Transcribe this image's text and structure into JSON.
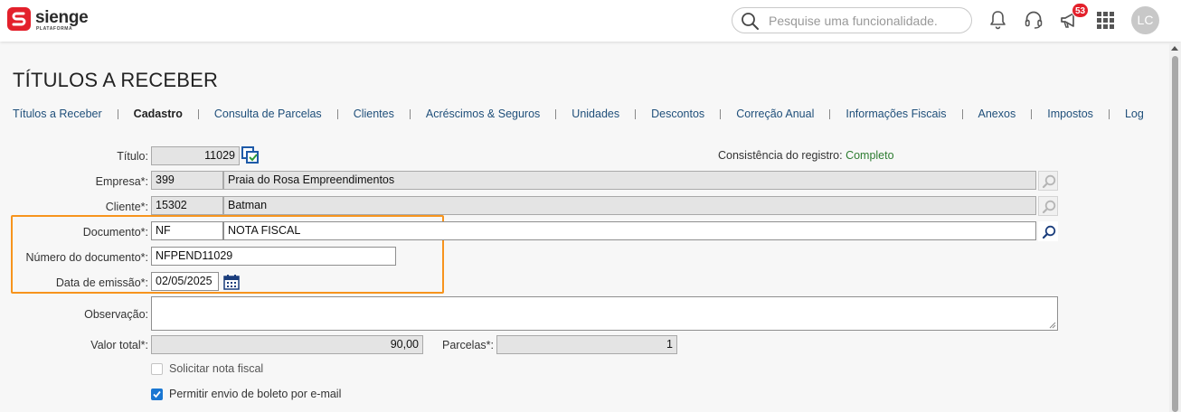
{
  "header": {
    "brand": "sienge",
    "brand_sub": "PLATAFORMA",
    "search_placeholder": "Pesquise uma funcionalidade.",
    "notifications_count": "53",
    "avatar_initials": "LC"
  },
  "page": {
    "title": "TÍTULOS A RECEBER"
  },
  "tabs": [
    {
      "label": "Títulos a Receber"
    },
    {
      "label": "Cadastro"
    },
    {
      "label": "Consulta de Parcelas"
    },
    {
      "label": "Clientes"
    },
    {
      "label": "Acréscimos & Seguros"
    },
    {
      "label": "Unidades"
    },
    {
      "label": "Descontos"
    },
    {
      "label": "Correção Anual"
    },
    {
      "label": "Informações Fiscais"
    },
    {
      "label": "Anexos"
    },
    {
      "label": "Impostos"
    },
    {
      "label": "Log"
    }
  ],
  "form": {
    "titulo": {
      "label": "Título:",
      "value": "11029"
    },
    "consistencia": {
      "label": "Consistência do registro:",
      "value": "Completo"
    },
    "empresa": {
      "label": "Empresa*:",
      "code": "399",
      "name": "Praia do Rosa Empreendimentos"
    },
    "cliente": {
      "label": "Cliente*:",
      "code": "15302",
      "name": "Batman"
    },
    "documento": {
      "label": "Documento*:",
      "code": "NF",
      "name": "NOTA FISCAL"
    },
    "numero_documento": {
      "label": "Número do documento*:",
      "value": "NFPEND11029"
    },
    "data_emissao": {
      "label": "Data de emissão*:",
      "value": "02/05/2025"
    },
    "observacao": {
      "label": "Observação:",
      "value": ""
    },
    "valor_total": {
      "label": "Valor total*:",
      "value": "90,00"
    },
    "parcelas": {
      "label": "Parcelas*:",
      "value": "1"
    },
    "solicitar_nf": {
      "label": "Solicitar nota fiscal",
      "checked": false
    },
    "permitir_boleto": {
      "label": "Permitir envio de boleto por e-mail",
      "checked": true
    }
  },
  "colors": {
    "accent_orange": "#f7941d",
    "brand_red": "#e3202b",
    "link_blue": "#1f4f7a",
    "status_green": "#2e7d32",
    "checkbox_blue": "#1976d2"
  }
}
